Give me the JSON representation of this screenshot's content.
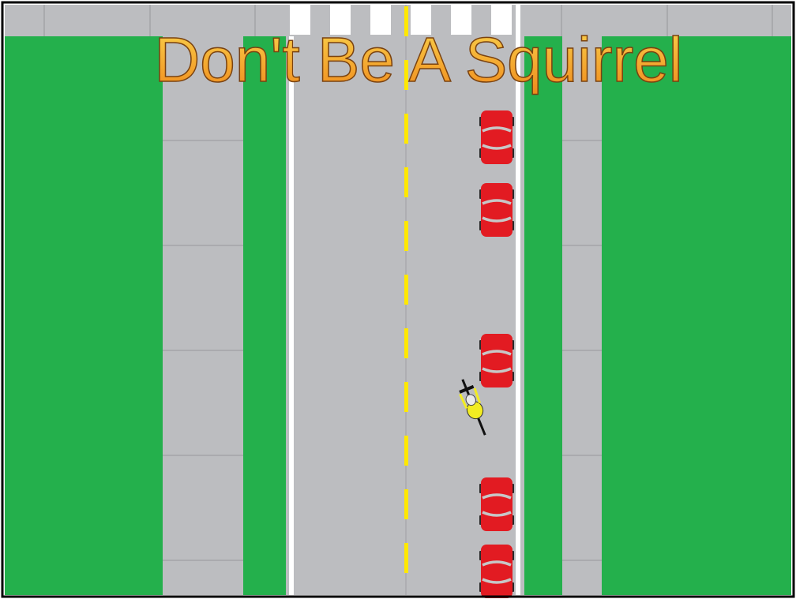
{
  "title": "Don't Be A Squirrel",
  "colors": {
    "grass": "#24B04C",
    "pavement": "#BCBDC0",
    "sidewalk_joint": "#A3A4A7",
    "lane_line": "#FFFFFF",
    "center_line": "#FFE800",
    "car_body": "#E21B22",
    "car_windshield": "#C7C7C7",
    "car_tire": "#2A2A2A",
    "cyclist_jersey": "#F2EC22",
    "cyclist_helmet": "#EAEAEA",
    "bicycle": "#111111",
    "title_fill_top": "#F9D24C",
    "title_fill_bottom": "#F08A1C",
    "title_outline": "#7A4210",
    "frame": "#000000"
  },
  "elements": {
    "parked_cars": 5,
    "cyclists": 1,
    "crosswalk_stripes": 6
  }
}
